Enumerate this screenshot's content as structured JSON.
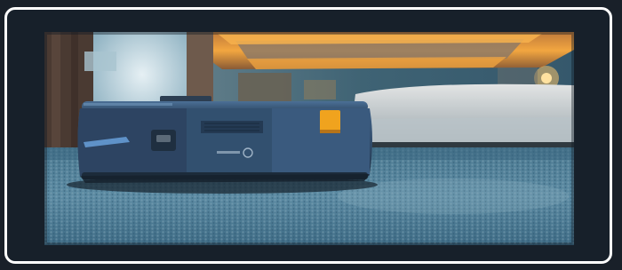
{
  "image": {
    "alt": "",
    "subject": "robot-vacuum-on-carpet",
    "robot_label": "",
    "colors": {
      "frame_border": "#ffffff",
      "frame_bg": "#17202a",
      "page_bg": "#192029",
      "ceiling_glow": "#f2a640",
      "robot_body": "#3c5b80",
      "robot_button": "#f0a31e",
      "carpet": "#4f7f99"
    }
  }
}
